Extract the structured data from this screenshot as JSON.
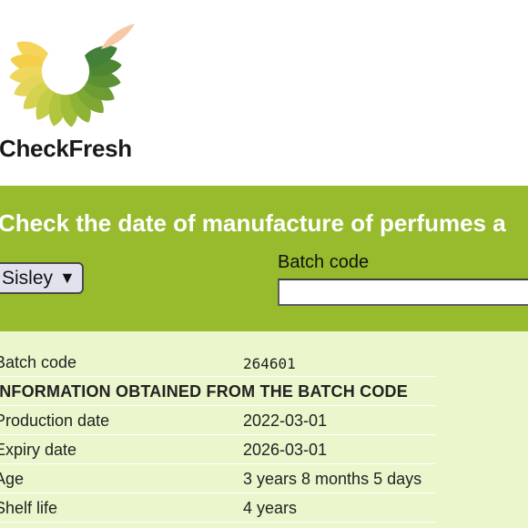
{
  "brand": {
    "name": "CheckFresh"
  },
  "banner": {
    "headline": "Check the date of manufacture of perfumes a"
  },
  "form": {
    "brand_selected": "Sisley",
    "brand_caret": "▼",
    "batch_label": "Batch code",
    "batch_value": ""
  },
  "results": {
    "batch_code_label": "Batch code",
    "batch_code_value": "264601",
    "section_heading": "INFORMATION OBTAINED FROM THE BATCH CODE",
    "rows": [
      {
        "label": "Production date",
        "value": "2022-03-01"
      },
      {
        "label": "Expiry date",
        "value": "2026-03-01"
      },
      {
        "label": "Age",
        "value": "3 years 8 months 5 days"
      },
      {
        "label": "Shelf life",
        "value": "4 years"
      }
    ]
  },
  "colors": {
    "band_green": "#98bb2e",
    "results_bg": "#eaf6cc",
    "headline_text": "#ffffff"
  }
}
